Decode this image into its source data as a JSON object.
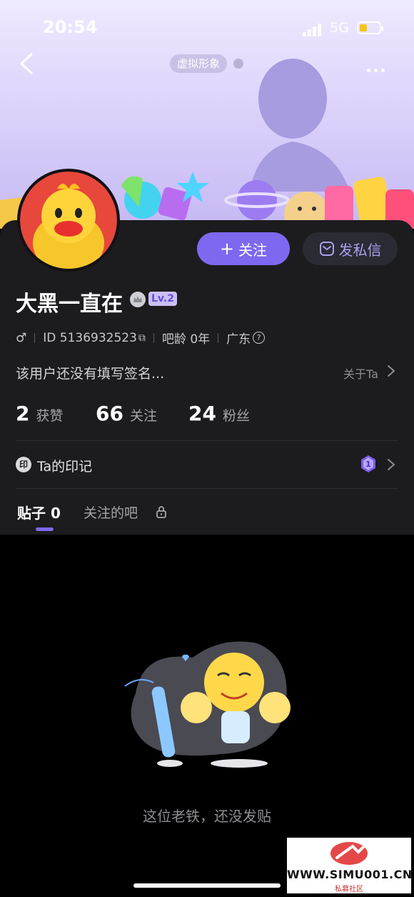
{
  "status_bar": {
    "time": "20:54",
    "network": "5G"
  },
  "header": {
    "virtual_tag": "虚拟形象"
  },
  "profile": {
    "name": "大黑一直在",
    "level": "Lv.2",
    "gender_symbol": "♂",
    "id": "ID 5136932523",
    "age": "吧龄 0年",
    "location": "广东",
    "signature": "该用户还没有填写签名...",
    "about_link": "关于Ta"
  },
  "actions": {
    "follow_label": "关注",
    "follow_plus": "+",
    "message_label": "发私信"
  },
  "stats": [
    {
      "number": "2",
      "label": "获赞"
    },
    {
      "number": "66",
      "label": "关注"
    },
    {
      "number": "24",
      "label": "粉丝"
    }
  ],
  "marks": {
    "badge": "印",
    "label": "Ta的印记",
    "medal_number": "1"
  },
  "tabs": [
    {
      "label": "贴子 0",
      "active": true
    },
    {
      "label": "关注的吧",
      "locked": true
    }
  ],
  "empty_state": {
    "message": "这位老铁，还没发贴"
  },
  "watermark": {
    "text": "WWW.SIMU001.CN",
    "sub": "私募社区"
  },
  "colors": {
    "accent": "#7f68f0",
    "panel": "#1c1c1e",
    "background": "#000000"
  }
}
